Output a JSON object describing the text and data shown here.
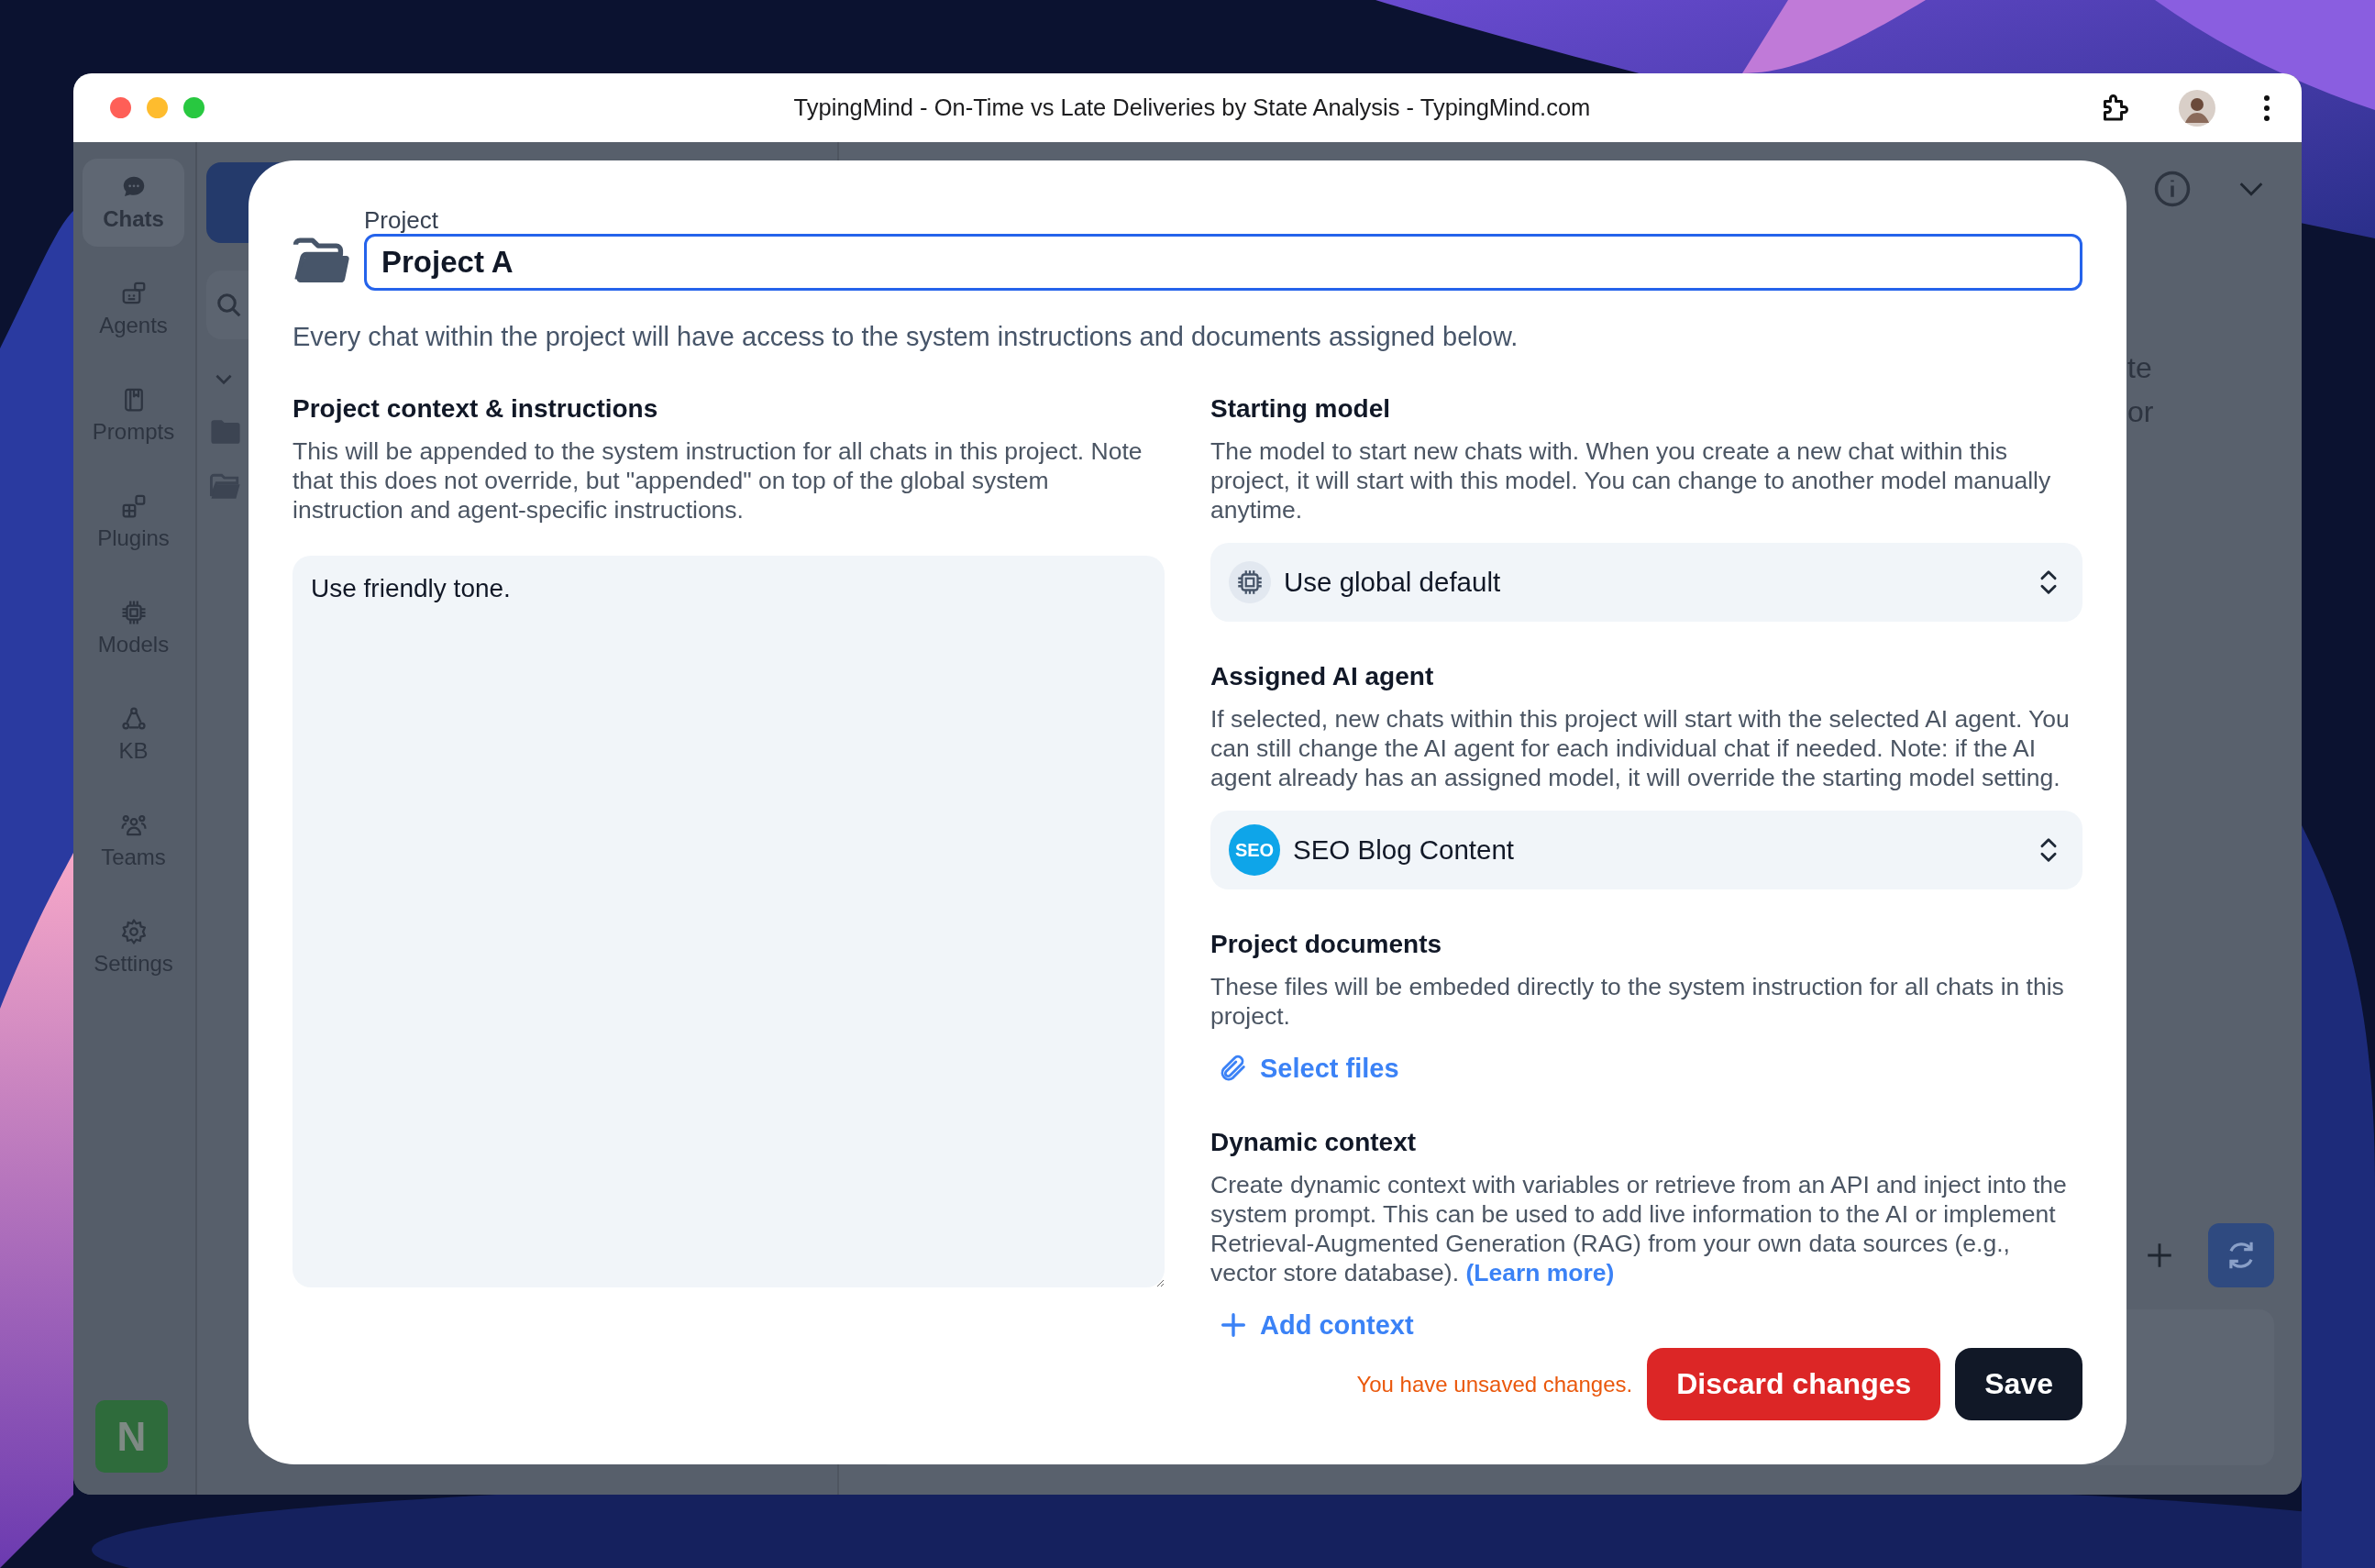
{
  "window": {
    "title": "TypingMind - On-Time vs Late Deliveries by State Analysis - TypingMind.com"
  },
  "sidebar": {
    "items": [
      {
        "label": "Chats",
        "selected": true
      },
      {
        "label": "Agents",
        "selected": false
      },
      {
        "label": "Prompts",
        "selected": false
      },
      {
        "label": "Plugins",
        "selected": false
      },
      {
        "label": "Models",
        "selected": false
      },
      {
        "label": "KB",
        "selected": false
      },
      {
        "label": "Teams",
        "selected": false
      },
      {
        "label": "Settings",
        "selected": false
      }
    ],
    "avatar": "N"
  },
  "background_text": [
    "te",
    "or"
  ],
  "modal": {
    "name_label": "Project",
    "name_value": "Project A",
    "intro": "Every chat within the project will have access to the system instructions and documents assigned below.",
    "context": {
      "heading": "Project context & instructions",
      "description": "This will be appended to the system instruction for all chats in this project. Note that this does not override, but \"appended\" on top of the global system instruction and agent-specific instructions.",
      "value": "Use friendly tone."
    },
    "sections": [
      {
        "kind": "model_select",
        "heading": "Starting model",
        "description": "The model to start new chats with. When you create a new chat within this project, it will start with this model. You can change to another model manually anytime.",
        "value": "Use global default"
      },
      {
        "kind": "agent_select",
        "heading": "Assigned AI agent",
        "description": "If selected, new chats within this project will start with the selected AI agent. You can still change the AI agent for each individual chat if needed. Note: if the AI agent already has an assigned model, it will override the starting model setting.",
        "badge": "SEO",
        "value": "SEO Blog Content"
      },
      {
        "kind": "file_upload",
        "heading": "Project documents",
        "description": "These files will be embeded directly to the system instruction for all chats in this project.",
        "action": "Select files"
      },
      {
        "kind": "dynamic_context",
        "heading": "Dynamic context",
        "description": "Create dynamic context with variables or retrieve from an API and inject into the system prompt. This can be used to add live information to the AI or implement Retrieval-Augmented Generation (RAG) from your own data sources (e.g., vector store database).",
        "link": "(Learn more)",
        "action": "Add context"
      }
    ],
    "footer": {
      "notice": "You have unsaved changes.",
      "buttons": [
        {
          "kind": "danger",
          "label": "Discard changes"
        },
        {
          "kind": "primary",
          "label": "Save"
        }
      ]
    }
  }
}
